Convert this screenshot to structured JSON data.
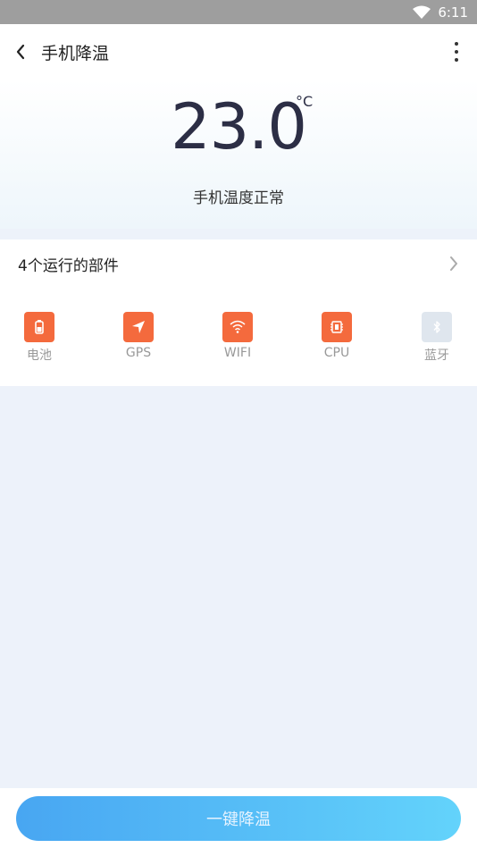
{
  "status_bar": {
    "time": "6:11"
  },
  "app_bar": {
    "title": "手机降温"
  },
  "hero": {
    "temperature": "23.0",
    "unit": "°C",
    "status": "手机温度正常"
  },
  "parts_panel": {
    "title": "4个运行的部件",
    "items": [
      {
        "label": "电池",
        "icon": "battery-icon",
        "active": true,
        "color": "#f46a3d"
      },
      {
        "label": "GPS",
        "icon": "navigation-arrow-icon",
        "active": true,
        "color": "#f46a3d"
      },
      {
        "label": "WIFI",
        "icon": "wifi-icon",
        "active": true,
        "color": "#f46a3d"
      },
      {
        "label": "CPU",
        "icon": "chip-icon",
        "active": true,
        "color": "#f46a3d"
      },
      {
        "label": "蓝牙",
        "icon": "bluetooth-icon",
        "active": false,
        "color": "#dfe6ee"
      }
    ]
  },
  "action": {
    "cool_label": "一键降温"
  }
}
